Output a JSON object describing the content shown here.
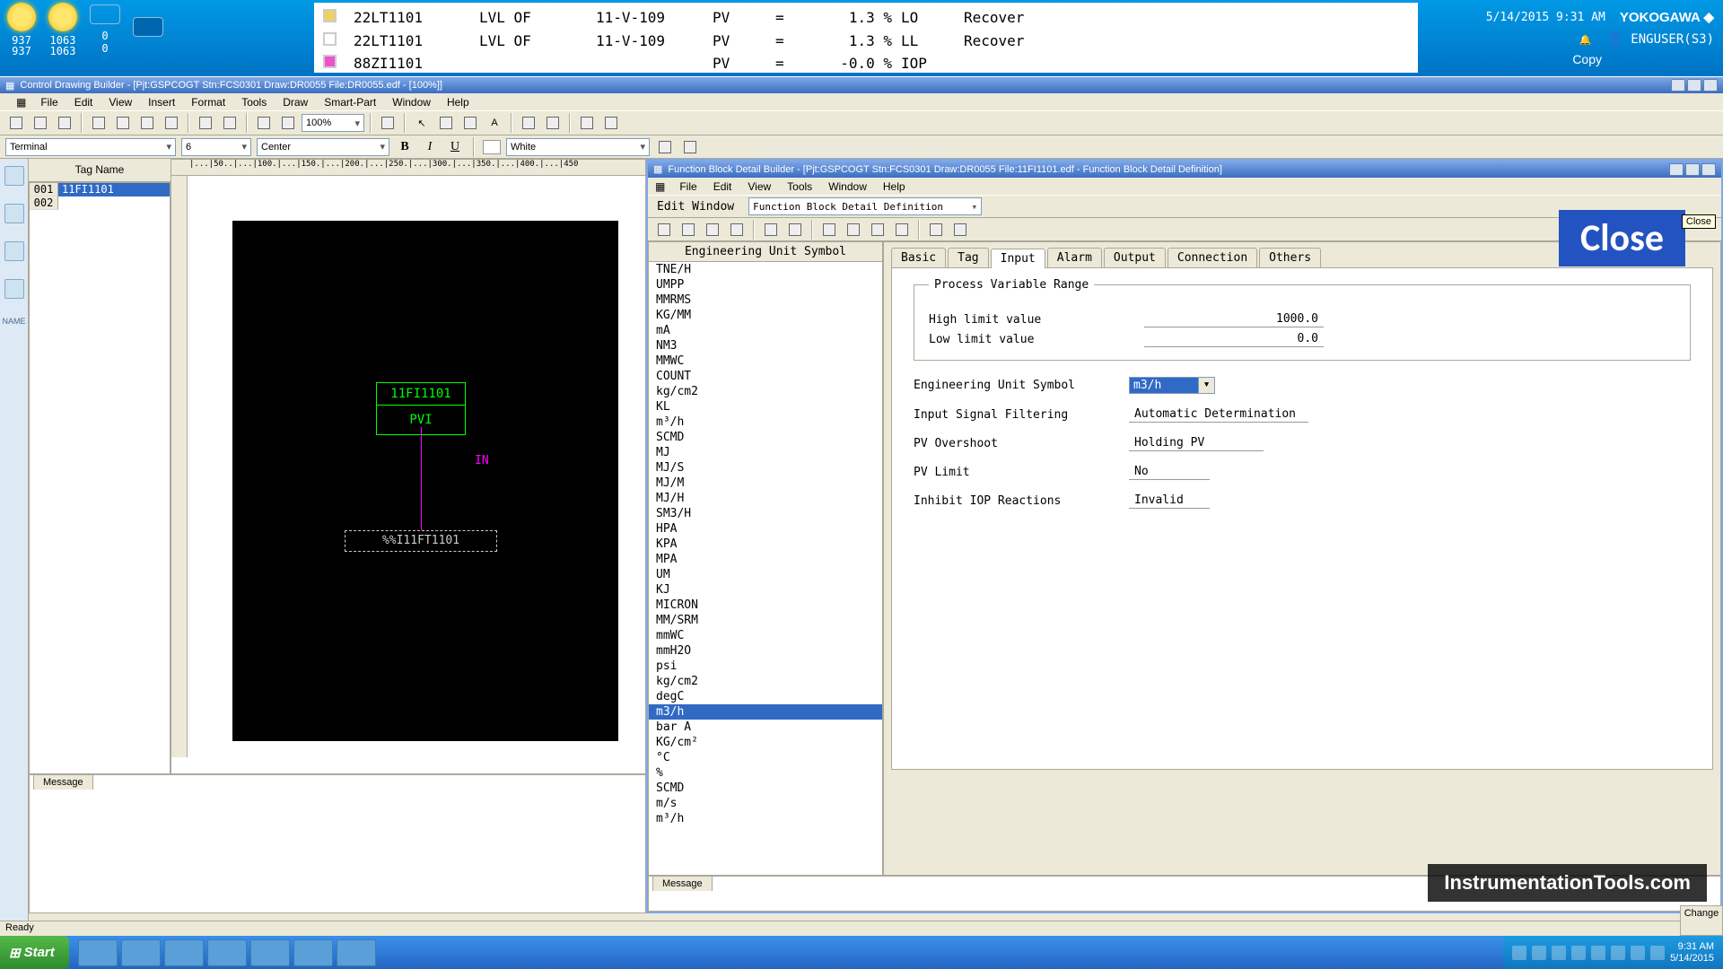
{
  "topbar": {
    "weather": [
      {
        "v1": "937",
        "v2": "937"
      },
      {
        "v1": "1063",
        "v2": "1063"
      },
      {
        "v1": "0",
        "v2": "0"
      }
    ],
    "alarms": [
      {
        "tag": "22LT1101",
        "desc": "LVL OF",
        "src": "11-V-109",
        "pv": "PV",
        "eq": "=",
        "val": "1.3 %",
        "code": "LO",
        "stat": "Recover",
        "color": "#f0d060"
      },
      {
        "tag": "22LT1101",
        "desc": "LVL OF",
        "src": "11-V-109",
        "pv": "PV",
        "eq": "=",
        "val": "1.3 %",
        "code": "LL",
        "stat": "Recover",
        "color": "#fff"
      },
      {
        "tag": "88ZI1101",
        "desc": "",
        "src": "",
        "pv": "PV",
        "eq": "=",
        "val": "-0.0 %",
        "code": "IOP",
        "stat": "",
        "color": "#f050d0"
      }
    ],
    "time": "5/14/2015 9:31 AM",
    "logo": "YOKOGAWA ◆",
    "copy": "Copy",
    "user": "ENGUSER(S3)"
  },
  "outer_window": {
    "title": "Control Drawing Builder - [Pjt:GSPCOGT Stn:FCS0301 Draw:DR0055 File:DR0055.edf - [100%]]",
    "menus": [
      "File",
      "Edit",
      "View",
      "Insert",
      "Format",
      "Tools",
      "Draw",
      "Smart-Part",
      "Window",
      "Help"
    ],
    "zoom": "100%",
    "terminal_label": "Terminal",
    "font_size": "6",
    "align": "Center",
    "color": "White",
    "tree_header": "Tag Name",
    "tree_items": [
      {
        "n": "001",
        "v": "11FI1101"
      },
      {
        "n": "002",
        "v": ""
      }
    ],
    "fb_block": {
      "tag": "11FI1101",
      "type": "PVI",
      "in": "IN",
      "src": "%%I11FT1101"
    },
    "ruler": "|...|50..|...|100.|...|150.|...|200.|...|250.|...|300.|...|350.|...|400.|...|450",
    "msg_tab": "Message",
    "status": "Ready"
  },
  "sub_window": {
    "title": "Function Block Detail Builder - [Pjt:GSPCOGT Stn:FCS0301 Draw:DR0055 File:11FI1101.edf - Function Block Detail Definition]",
    "menus": [
      "File",
      "Edit",
      "View",
      "Tools",
      "Window",
      "Help"
    ],
    "edit_window_label": "Edit Window",
    "edit_combo": "Function Block Detail Definition",
    "unit_title": "Engineering Unit Symbol",
    "units": [
      "TNE/H",
      "UMPP",
      "MMRMS",
      "KG/MM",
      "mA",
      "NM3",
      "MMWC",
      "COUNT",
      "kg/cm2",
      "KL",
      "m³/h",
      "SCMD",
      "MJ",
      "MJ/S",
      "MJ/M",
      "MJ/H",
      "SM3/H",
      "HPA",
      "KPA",
      "MPA",
      "UM",
      "KJ",
      "MICRON",
      "MM/SRM",
      "mmWC",
      "mmH2O",
      "psi",
      "kg/cm2",
      "degC",
      "m3/h",
      "bar A",
      "KG/cm²",
      "°C",
      "%",
      "SCMD",
      "m/s",
      " m³/h"
    ],
    "selected_unit": "m3/h",
    "tabs": [
      "Basic",
      "Tag",
      "Input",
      "Alarm",
      "Output",
      "Connection",
      "Others"
    ],
    "active_tab": "Input",
    "fieldset": "Process Variable Range",
    "fields": {
      "high_label": "High limit value",
      "high_val": "1000.0",
      "low_label": "Low limit value",
      "low_val": "0.0",
      "eus_label": "Engineering Unit Symbol",
      "eus_val": "m3/h",
      "filt_label": "Input Signal Filtering",
      "filt_val": "Automatic Determination",
      "over_label": "PV Overshoot",
      "over_val": "Holding PV",
      "lim_label": "PV Limit",
      "lim_val": "No",
      "iop_label": "Inhibit IOP Reactions",
      "iop_val": "Invalid"
    },
    "close_overlay": "Close",
    "close_tip": "Close",
    "msg_tab": "Message"
  },
  "change_label": "Change",
  "taskbar": {
    "start": "Start",
    "time": "9:31 AM",
    "date": "5/14/2015"
  },
  "watermark": "InstrumentationTools.com",
  "badge": "InstrumentationTools.com",
  "left_strip": [
    "",
    "",
    "",
    "",
    "NAME",
    ""
  ]
}
